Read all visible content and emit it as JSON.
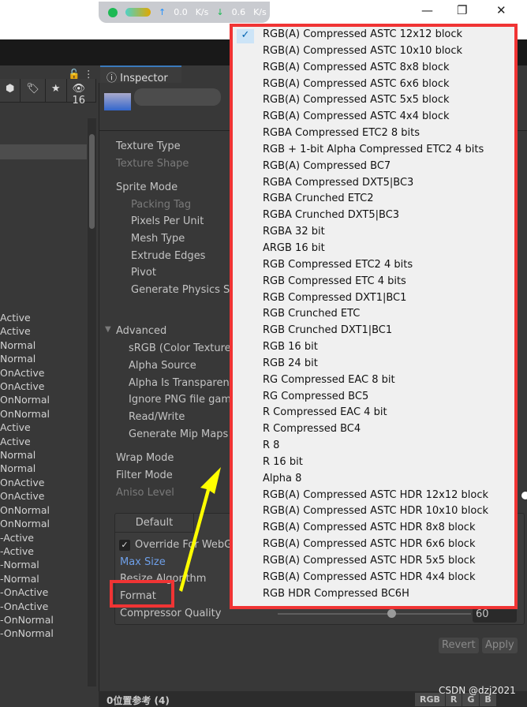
{
  "netbar": {
    "up": "0.0",
    "up_unit": "K/s",
    "down": "0.6",
    "down_unit": "K/s"
  },
  "window": {
    "minimize": "—",
    "maximize": "❐",
    "close": "✕"
  },
  "hierarchy": {
    "toolbar": [
      "⬢",
      "🏷",
      "★",
      "👁16"
    ],
    "lock": "🔓",
    "more": "⋮",
    "items": [
      "Active",
      "Active",
      "Normal",
      "Normal",
      "OnActive",
      "OnActive",
      "OnNormal",
      "OnNormal",
      "Active",
      "Active",
      "Normal",
      "Normal",
      "OnActive",
      "OnActive",
      "OnNormal",
      "OnNormal",
      "-Active",
      "-Active",
      "-Normal",
      "-Normal",
      "-OnActive",
      "-OnActive",
      "-OnNormal",
      "-OnNormal"
    ]
  },
  "inspector": {
    "tab": "Inspector",
    "labels": {
      "texture_type": "Texture Type",
      "texture_shape": "Texture Shape",
      "sprite_mode": "Sprite Mode",
      "packing_tag": "Packing Tag",
      "pixels_per_unit": "Pixels Per Unit",
      "mesh_type": "Mesh Type",
      "extrude_edges": "Extrude Edges",
      "pivot": "Pivot",
      "generate_physics": "Generate Physics Sh",
      "advanced": "Advanced",
      "srgb": "sRGB (Color Texture",
      "alpha_source": "Alpha Source",
      "alpha_transparency": "Alpha Is Transparency",
      "ignore_png": "Ignore PNG file gamma",
      "read_write": "Read/Write",
      "mip_maps": "Generate Mip Maps",
      "wrap_mode": "Wrap Mode",
      "filter_mode": "Filter Mode",
      "aniso_level": "Aniso Level"
    },
    "platform": {
      "default_tab": "Default",
      "override": "Override For WebG",
      "max_size": "Max Size",
      "resize_algorithm": "Resize Algorithm",
      "format": "Format",
      "compressor_quality": "Compressor Quality",
      "quality_value": "60",
      "quality_percent": 60
    },
    "revert": "Revert",
    "apply": "Apply"
  },
  "bottom": {
    "title": "0位置参考 (4)",
    "channels": [
      "RGB",
      "R",
      "G",
      "B"
    ]
  },
  "watermark": "CSDN @dzj2021",
  "format_dropdown": {
    "selected": "RGB(A) Compressed ASTC 12x12 block",
    "options": [
      "RGB(A) Compressed ASTC 12x12 block",
      "RGB(A) Compressed ASTC 10x10 block",
      "RGB(A) Compressed ASTC 8x8 block",
      "RGB(A) Compressed ASTC 6x6 block",
      "RGB(A) Compressed ASTC 5x5 block",
      "RGB(A) Compressed ASTC 4x4 block",
      "RGBA Compressed ETC2 8 bits",
      "RGB + 1-bit Alpha Compressed ETC2 4 bits",
      "RGB(A) Compressed BC7",
      "RGBA Compressed DXT5|BC3",
      "RGBA Crunched ETC2",
      "RGBA Crunched DXT5|BC3",
      "RGBA 32 bit",
      "ARGB 16 bit",
      "RGB Compressed ETC2 4 bits",
      "RGB Compressed ETC 4 bits",
      "RGB Compressed DXT1|BC1",
      "RGB Crunched ETC",
      "RGB Crunched DXT1|BC1",
      "RGB 16 bit",
      "RGB 24 bit",
      "RG Compressed EAC 8 bit",
      "RG Compressed BC5",
      "R Compressed EAC 4 bit",
      "R Compressed BC4",
      "R 8",
      "R 16 bit",
      "Alpha 8",
      "RGB(A) Compressed ASTC HDR 12x12 block",
      "RGB(A) Compressed ASTC HDR 10x10 block",
      "RGB(A) Compressed ASTC HDR 8x8 block",
      "RGB(A) Compressed ASTC HDR 6x6 block",
      "RGB(A) Compressed ASTC HDR 5x5 block",
      "RGB(A) Compressed ASTC HDR 4x4 block",
      "RGB HDR Compressed BC6H"
    ]
  },
  "colors": {
    "highlight": "#f03434",
    "arrow": "#ffff00",
    "accent": "#3a79bb",
    "link": "#6e9fe8"
  }
}
